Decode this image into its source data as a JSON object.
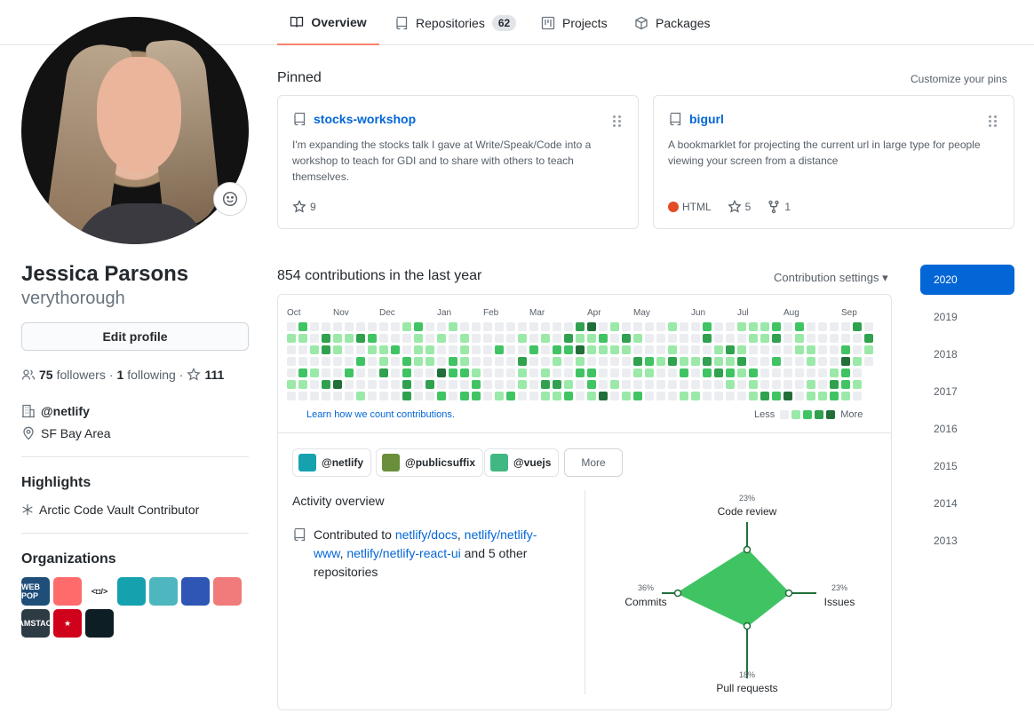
{
  "nav": {
    "tabs": [
      {
        "label": "Overview",
        "icon": "book-icon"
      },
      {
        "label": "Repositories",
        "icon": "repo-icon",
        "count": "62"
      },
      {
        "label": "Projects",
        "icon": "project-icon"
      },
      {
        "label": "Packages",
        "icon": "package-icon"
      }
    ]
  },
  "profile": {
    "name": "Jessica Parsons",
    "login": "verythorough",
    "edit_label": "Edit profile",
    "followers_count": "75",
    "followers_label": "followers",
    "sep1": "·",
    "following_count": "1",
    "following_label": "following",
    "sep2": "·",
    "stars": "111",
    "company": "@netlify",
    "location": "SF Bay Area",
    "highlights_title": "Highlights",
    "highlight": "Arctic Code Vault Contributor",
    "orgs_title": "Organizations",
    "org_logos": [
      {
        "text": "WEB POP",
        "color": "#1f4e79"
      },
      {
        "text": "",
        "color": "#ff6b6b"
      },
      {
        "text": "<◘/>",
        "color": "#ffffff"
      },
      {
        "text": "",
        "color": "#15a2ae"
      },
      {
        "text": "",
        "color": "#4eb6be"
      },
      {
        "text": "",
        "color": "#2f55b5"
      },
      {
        "text": "",
        "color": "#f17a7a"
      },
      {
        "text": "JAMSTACK",
        "color": "#2d3b45"
      },
      {
        "text": "★",
        "color": "#d0021b"
      },
      {
        "text": "",
        "color": "#0e1e25"
      }
    ]
  },
  "pinned": {
    "title": "Pinned",
    "customize": "Customize your pins",
    "repos": [
      {
        "name": "stocks-workshop",
        "description": "I'm expanding the stocks talk I gave at Write/Speak/Code into a workshop to teach for GDI and to share with others to teach themselves.",
        "stars": "9"
      },
      {
        "name": "bigurl",
        "description": "A bookmarklet for projecting the current url in large type for people viewing your screen from a distance",
        "language": "HTML",
        "language_color": "#e34c26",
        "stars": "5",
        "forks": "1"
      }
    ]
  },
  "contributions": {
    "title": "854 contributions in the last year",
    "settings": "Contribution settings ▾",
    "months": [
      "Oct",
      "Nov",
      "Dec",
      "Jan",
      "Feb",
      "Mar",
      "Apr",
      "May",
      "Jun",
      "Jul",
      "Aug",
      "Sep"
    ],
    "learn": "Learn how we count contributions.",
    "less": "Less",
    "more": "More",
    "level_colors": [
      "#ebedf0",
      "#9be9a8",
      "#40c463",
      "#30a14e",
      "#216e39"
    ]
  },
  "activity": {
    "orgs": [
      {
        "label": "@netlify",
        "color": "#15a2ae"
      },
      {
        "label": "@publicsuffix",
        "color": "#6a8f3c"
      },
      {
        "label": "@vuejs",
        "color": "#41b883"
      }
    ],
    "more": "More",
    "overview_title": "Activity overview",
    "contributed_prefix": "Contributed to",
    "repo1": "netlify/docs",
    "repo2": "netlify/netlify-www",
    "repo3": "netlify/netlify-react-ui",
    "others": "and 5 other repositories",
    "radar": {
      "code_review_pct": "23%",
      "code_review": "Code review",
      "commits_pct": "36%",
      "commits": "Commits",
      "issues_pct": "23%",
      "issues": "Issues",
      "pull_requests_pct": "18%",
      "pull_requests": "Pull requests",
      "color": "#40c463"
    }
  },
  "years": [
    "2020",
    "2019",
    "2018",
    "2017",
    "2016",
    "2015",
    "2014",
    "2013"
  ]
}
